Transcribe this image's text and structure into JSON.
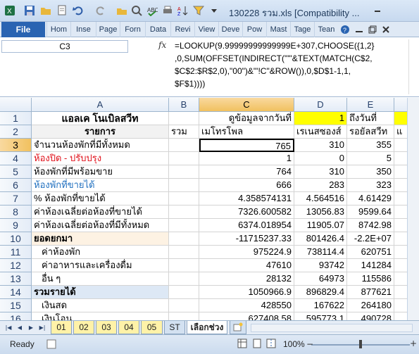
{
  "window": {
    "title": "130228 รวม.xls  [Compatibility ..."
  },
  "ribbon": {
    "file_tab": "File",
    "tabs": [
      "Hom",
      "Inse",
      "Page",
      "Forn",
      "Data",
      "Revi",
      "View",
      "Deve",
      "Pow",
      "Mast",
      "Tage",
      "Tean"
    ]
  },
  "formula_bar": {
    "name_box": "C3",
    "fx": "fx",
    "formula": "=LOOKUP(9.99999999999999E+307,CHOOSE({1,2}\n,0,SUM(OFFSET(INDIRECT(\"'\"&TEXT(MATCH(C$2,\n$C$2:$R$2,0),\"00\")&\"'!C\"&ROW()),0,$D$1-1,1,\n$F$1))))"
  },
  "columns": [
    "A",
    "B",
    "C",
    "D",
    "E",
    ""
  ],
  "rows": [
    {
      "n": "1",
      "a": "แอลเค โนเบิลสวีท",
      "b": "",
      "c": "ดูข้อมูลจากวันที่",
      "d": "1",
      "e": "ถึงวันที่",
      "f": ""
    },
    {
      "n": "2",
      "a": "รายการ",
      "b": "รวม",
      "c": "เมโทรโพล",
      "d": "เรเนสซองส์",
      "e": "รอยัลสวีท",
      "f": "แ"
    },
    {
      "n": "3",
      "a": "จำนวนห้องพักที่มีทั้งหมด",
      "b": "",
      "c": "765",
      "d": "310",
      "e": "355",
      "f": ""
    },
    {
      "n": "4",
      "a": "ห้องปิด - ปรับปรุง",
      "b": "",
      "c": "1",
      "d": "0",
      "e": "5",
      "f": ""
    },
    {
      "n": "5",
      "a": "ห้องพักที่มีพร้อมขาย",
      "b": "",
      "c": "764",
      "d": "310",
      "e": "350",
      "f": ""
    },
    {
      "n": "6",
      "a": "ห้องพักที่ขายได้",
      "b": "",
      "c": "666",
      "d": "283",
      "e": "323",
      "f": ""
    },
    {
      "n": "7",
      "a": "% ห้องพักที่ขายได้",
      "b": "",
      "c": "4.358574131",
      "d": "4.564516",
      "e": "4.61429",
      "f": ""
    },
    {
      "n": "8",
      "a": "ค่าห้องเฉลี่ยต่อห้องที่ขายได้",
      "b": "",
      "c": "7326.600582",
      "d": "13056.83",
      "e": "9599.64",
      "f": ""
    },
    {
      "n": "9",
      "a": "ค่าห้องเฉลี่ยต่อห้องที่มีทั้งหมด",
      "b": "",
      "c": "6374.018954",
      "d": "11905.07",
      "e": "8742.98",
      "f": ""
    },
    {
      "n": "10",
      "a": "ยอดยกมา",
      "b": "",
      "c": "-11715237.33",
      "d": "801426.4",
      "e": "-2.2E+07",
      "f": ""
    },
    {
      "n": "11",
      "a": "ค่าห้องพัก",
      "b": "",
      "c": "975224.9",
      "d": "738114.4",
      "e": "620751",
      "f": ""
    },
    {
      "n": "12",
      "a": "ค่าอาหารและเครื่องดื่ม",
      "b": "",
      "c": "47610",
      "d": "93742",
      "e": "141284",
      "f": ""
    },
    {
      "n": "13",
      "a": "อื่น ๆ",
      "b": "",
      "c": "28132",
      "d": "64973",
      "e": "115586",
      "f": ""
    },
    {
      "n": "14",
      "a": "รวมรายได้",
      "b": "",
      "c": "1050966.9",
      "d": "896829.4",
      "e": "877621",
      "f": ""
    },
    {
      "n": "15",
      "a": "เงินสด",
      "b": "",
      "c": "428550",
      "d": "167622",
      "e": "264180",
      "f": ""
    },
    {
      "n": "16",
      "a": "เงินโอน",
      "b": "",
      "c": "627408.58",
      "d": "595773.1",
      "e": "490728",
      "f": ""
    }
  ],
  "sheet_tabs": [
    "01",
    "02",
    "03",
    "04",
    "05",
    "ST",
    "เลือกช่วง"
  ],
  "status": {
    "ready": "Ready",
    "zoom": "100%"
  }
}
